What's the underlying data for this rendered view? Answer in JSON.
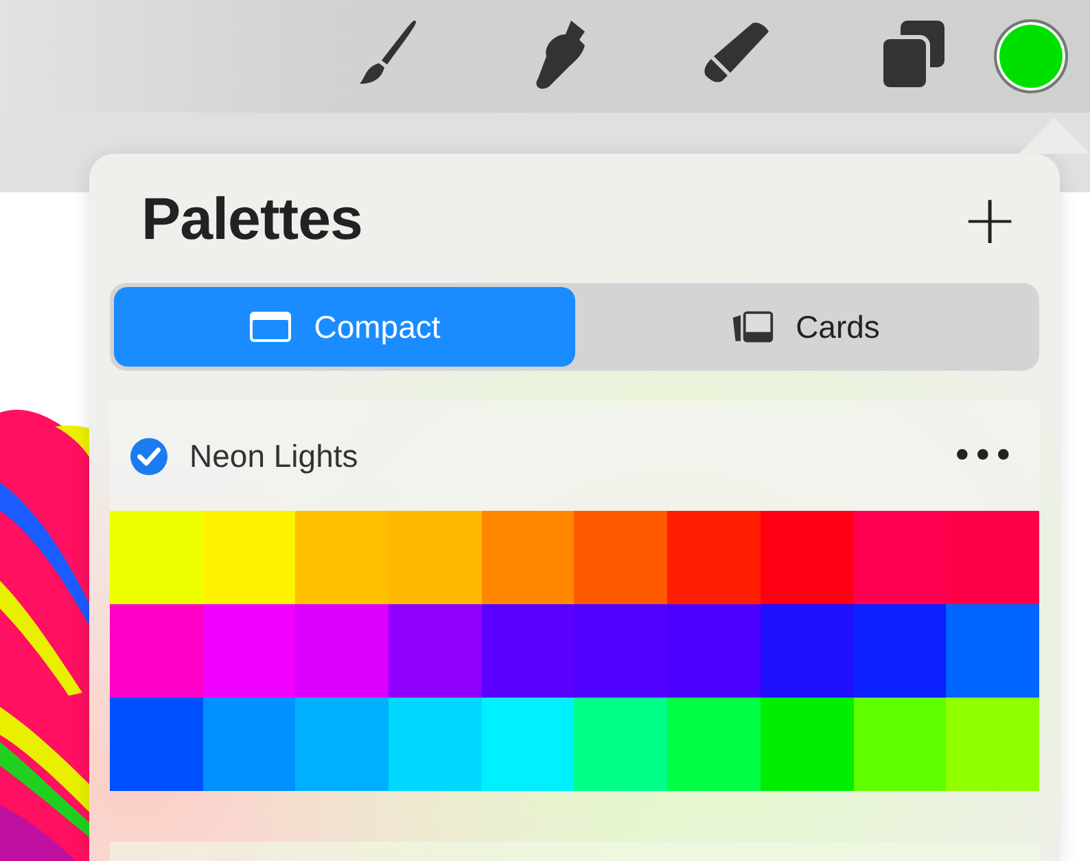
{
  "toolbar": {
    "tools": [
      {
        "kind": "brush"
      },
      {
        "kind": "smudge"
      },
      {
        "kind": "eraser"
      },
      {
        "kind": "layers"
      }
    ],
    "current_color": {
      "color": "#00e000"
    }
  },
  "palettes_panel": {
    "title": "Palettes",
    "add_button": "+",
    "tabs": [
      {
        "label": "Compact",
        "kind": "compact",
        "selected": true
      },
      {
        "label": "Cards",
        "kind": "cards",
        "selected": false
      }
    ],
    "palettes": [
      {
        "name": "Neon Lights",
        "checked": true,
        "more": "•••",
        "swatches": [
          {
            "color": "#eeff00"
          },
          {
            "color": "#fff200"
          },
          {
            "color": "#ffc000"
          },
          {
            "color": "#ffb800"
          },
          {
            "color": "#ff8800"
          },
          {
            "color": "#ff5a00"
          },
          {
            "color": "#ff1e00"
          },
          {
            "color": "#ff0012"
          },
          {
            "color": "#ff0050"
          },
          {
            "color": "#ff0048"
          },
          {
            "color": "#ff00c8"
          },
          {
            "color": "#f000ff"
          },
          {
            "color": "#dc00ff"
          },
          {
            "color": "#9000ff"
          },
          {
            "color": "#5a00ff"
          },
          {
            "color": "#5000ff"
          },
          {
            "color": "#4a00ff"
          },
          {
            "color": "#2010ff"
          },
          {
            "color": "#0a20ff"
          },
          {
            "color": "#0064ff"
          },
          {
            "color": "#0050ff"
          },
          {
            "color": "#0090ff"
          },
          {
            "color": "#00b0ff"
          },
          {
            "color": "#00d8ff"
          },
          {
            "color": "#00f0ff"
          },
          {
            "color": "#00ff88"
          },
          {
            "color": "#00ff44"
          },
          {
            "color": "#00ee00"
          },
          {
            "color": "#60ff00"
          },
          {
            "color": "#90ff00"
          }
        ]
      }
    ]
  }
}
